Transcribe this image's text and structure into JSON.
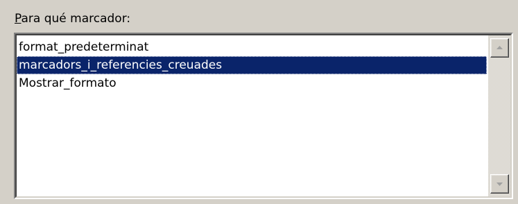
{
  "label": {
    "mnemonic": "P",
    "rest": "ara qué marcador:"
  },
  "bookmarks": {
    "items": [
      "format_predeterminat",
      "marcadors_i_referencies_creuades",
      "Mostrar_formato"
    ],
    "selected_index": 1
  },
  "scrollbar": {
    "up_icon": "scroll-up-arrow",
    "down_icon": "scroll-down-arrow"
  },
  "colors": {
    "window_bg": "#d4d0c8",
    "list_bg": "#ffffff",
    "selection_bg": "#0a246a",
    "selection_text": "#ffffff"
  }
}
